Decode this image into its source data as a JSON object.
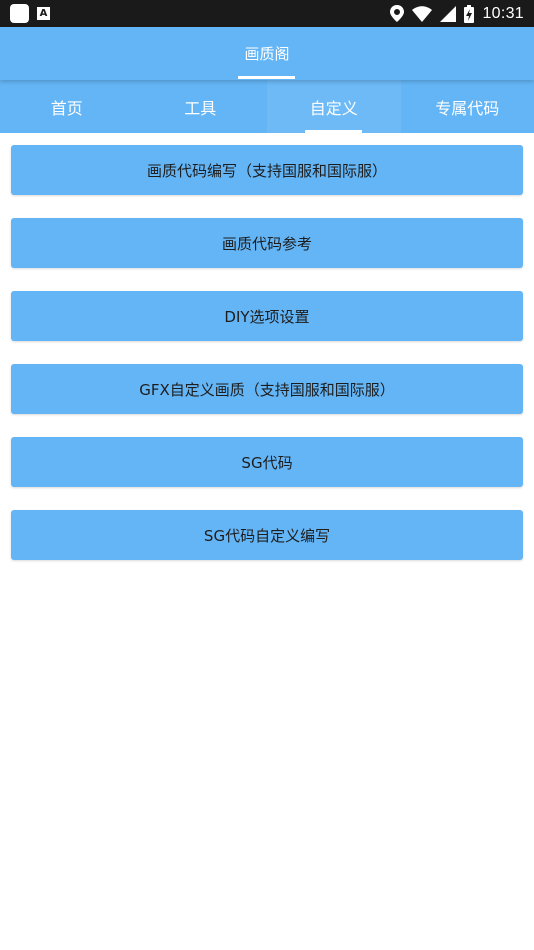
{
  "status_bar": {
    "time": "10:31",
    "left_icons": [
      "app-square-icon",
      "font-a-icon"
    ],
    "right_icons": [
      "location-icon",
      "wifi-icon",
      "signal-icon",
      "battery-charging-icon"
    ]
  },
  "app_bar": {
    "title": "画质阁"
  },
  "tabs": [
    {
      "label": "首页",
      "active": false
    },
    {
      "label": "工具",
      "active": false
    },
    {
      "label": "自定义",
      "active": true
    },
    {
      "label": "专属代码",
      "active": false
    }
  ],
  "buttons": [
    {
      "label": "画质代码编写（支持国服和国际服）"
    },
    {
      "label": "画质代码参考"
    },
    {
      "label": "DIY选项设置"
    },
    {
      "label": "GFX自定义画质（支持国服和国际服）"
    },
    {
      "label": "SG代码"
    },
    {
      "label": "SG代码自定义编写"
    }
  ],
  "colors": {
    "primary": "#64b5f6",
    "status_bar": "#1a1a1a",
    "background": "#ffffff",
    "button_text": "#1d1d1d"
  }
}
